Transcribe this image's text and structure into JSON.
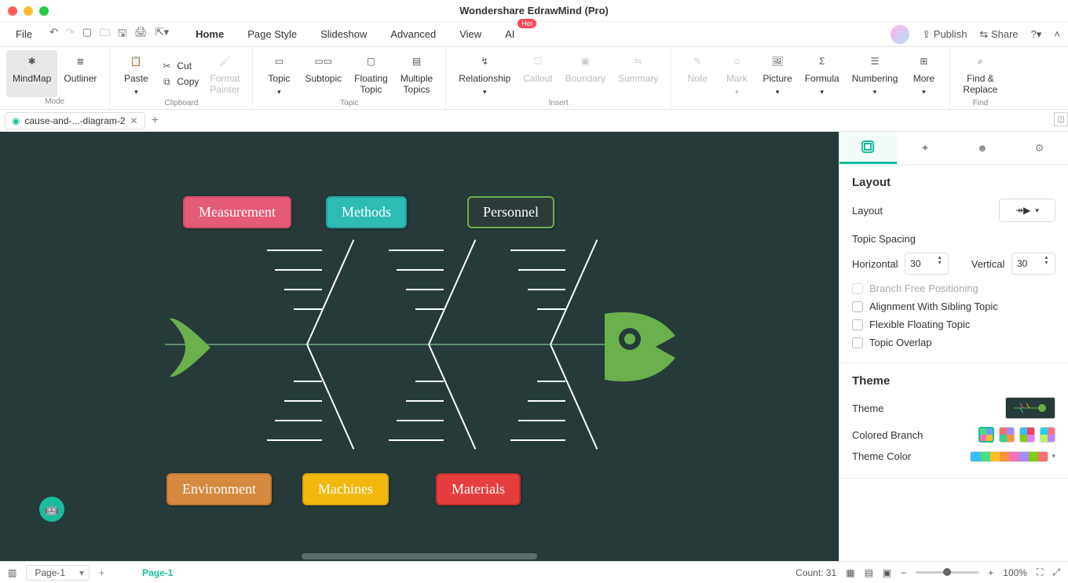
{
  "app_title": "Wondershare EdrawMind (Pro)",
  "file_menu": "File",
  "menu_tabs": [
    "Home",
    "Page Style",
    "Slideshow",
    "Advanced",
    "View",
    "AI"
  ],
  "active_menu_tab": "Home",
  "publish": "Publish",
  "share": "Share",
  "ribbon": {
    "mode_group": "Mode",
    "mindmap": "MindMap",
    "outliner": "Outliner",
    "clipboard_group": "Clipboard",
    "paste": "Paste",
    "cut": "Cut",
    "copy": "Copy",
    "format_painter": "Format\nPainter",
    "topic_group": "Topic",
    "topic": "Topic",
    "subtopic": "Subtopic",
    "floating_topic": "Floating\nTopic",
    "multiple_topics": "Multiple\nTopics",
    "relationship": "Relationship",
    "callout": "Callout",
    "boundary": "Boundary",
    "summary": "Summary",
    "insert_group": "Insert",
    "note": "Note",
    "mark": "Mark",
    "picture": "Picture",
    "formula": "Formula",
    "numbering": "Numbering",
    "more": "More",
    "find_group": "Find",
    "find_replace": "Find &\nReplace"
  },
  "doc_tab": "cause-and-...-diagram-2",
  "fishbone": {
    "top": [
      "Measurement",
      "Methods",
      "Personnel"
    ],
    "bottom": [
      "Environment",
      "Machines",
      "Materials"
    ]
  },
  "side": {
    "layout_title": "Layout",
    "layout_label": "Layout",
    "topic_spacing": "Topic Spacing",
    "horizontal": "Horizontal",
    "horizontal_val": "30",
    "vertical": "Vertical",
    "vertical_val": "30",
    "branch_free": "Branch Free Positioning",
    "align_sibling": "Alignment With Sibling Topic",
    "flex_float": "Flexible Floating Topic",
    "topic_overlap": "Topic Overlap",
    "theme_title": "Theme",
    "theme_label": "Theme",
    "colored_branch": "Colored Branch",
    "theme_color": "Theme Color"
  },
  "status": {
    "page_select": "Page-1",
    "page_current": "Page-1",
    "count": "Count: 31",
    "zoom": "100%"
  }
}
